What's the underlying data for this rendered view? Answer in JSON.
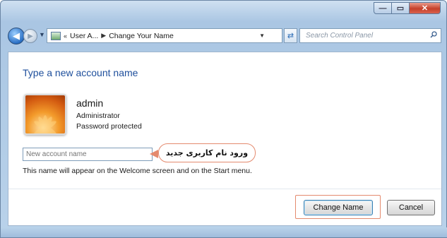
{
  "window": {
    "caption_minimize": "—",
    "caption_maximize": "▭",
    "caption_close": "✕"
  },
  "navigation": {
    "breadcrumb_parent": "User A...",
    "breadcrumb_current": "Change Your Name",
    "search_placeholder": "Search Control Panel",
    "icons": [
      "back-arrow-icon",
      "forward-arrow-icon",
      "control-panel-icon",
      "refresh-icon",
      "search-icon"
    ]
  },
  "main": {
    "heading": "Type a new account name",
    "user": {
      "name": "admin",
      "role": "Administrator",
      "status": "Password protected"
    },
    "input_placeholder": "New account name",
    "callout_text": "ورود نام کاربری جدید",
    "hint": "This name will appear on the Welcome screen and on the Start menu."
  },
  "buttons": {
    "change_name": "Change Name",
    "cancel": "Cancel"
  },
  "colors": {
    "heading": "#1e4f9c",
    "highlight": "#e48a6e",
    "frame": "#aac6e3"
  }
}
